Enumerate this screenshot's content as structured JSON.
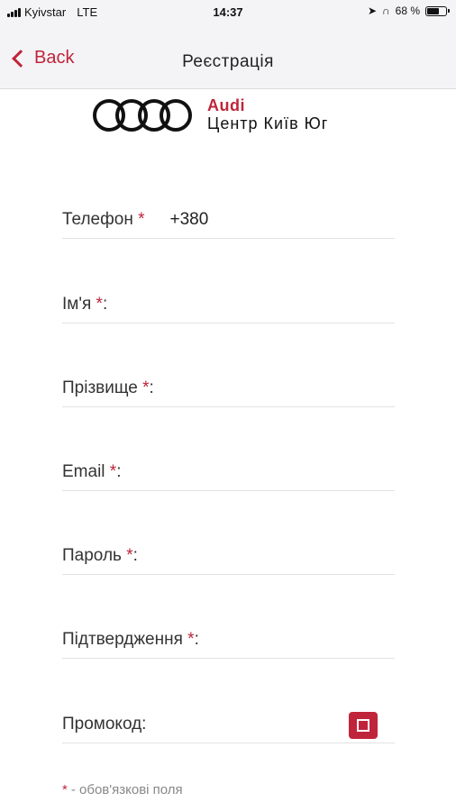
{
  "status_bar": {
    "carrier": "Kyivstar",
    "network": "LTE",
    "time": "14:37",
    "battery_percent": "68 %",
    "battery_level": 0.68
  },
  "nav": {
    "back_label": "Back",
    "title": "Реєстрація"
  },
  "logo": {
    "brand": "Audi",
    "subtitle": "Центр Київ Юг"
  },
  "form": {
    "required_mark": "*",
    "phone_label": "Телефон",
    "phone_value": "+380",
    "name_label": "Ім'я",
    "surname_label": "Прізвище",
    "email_label": "Email",
    "password_label": "Пароль",
    "confirm_label": "Підтвердження",
    "promo_label": "Промокод:",
    "colon": ":"
  },
  "footnote": {
    "mark": "*",
    "text": "- обов'язкові поля"
  },
  "colors": {
    "accent": "#c0243a",
    "nav_bg": "#f4f4f6"
  },
  "icons": {
    "scan": "qr-scan-icon",
    "back": "chevron-left-icon"
  }
}
